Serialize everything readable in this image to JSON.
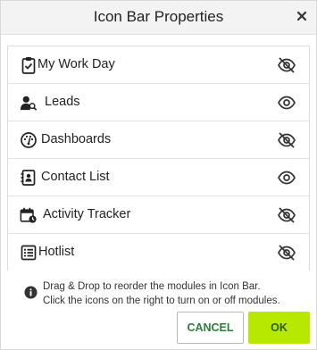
{
  "dialog": {
    "title": "Icon Bar Properties",
    "close_icon": "close-icon"
  },
  "modules": [
    {
      "label": "My Work Day",
      "icon": "clipboard-check-icon",
      "visible": false
    },
    {
      "label": "Leads",
      "icon": "user-search-icon",
      "visible": true
    },
    {
      "label": "Dashboards",
      "icon": "dashboard-gauge-icon",
      "visible": false
    },
    {
      "label": "Contact List",
      "icon": "contact-book-icon",
      "visible": true
    },
    {
      "label": "Activity Tracker",
      "icon": "calendar-clock-icon",
      "visible": false
    },
    {
      "label": "Hotlist",
      "icon": "list-icon",
      "visible": false
    }
  ],
  "info": {
    "icon": "info-icon",
    "line1": "Drag & Drop to reorder the modules in Icon Bar.",
    "line2": "Click the icons on the right to turn on or off modules."
  },
  "buttons": {
    "cancel": "CANCEL",
    "ok": "OK"
  },
  "colors": {
    "ok_background": "#b7e800",
    "cancel_text": "#2f7d3d"
  }
}
